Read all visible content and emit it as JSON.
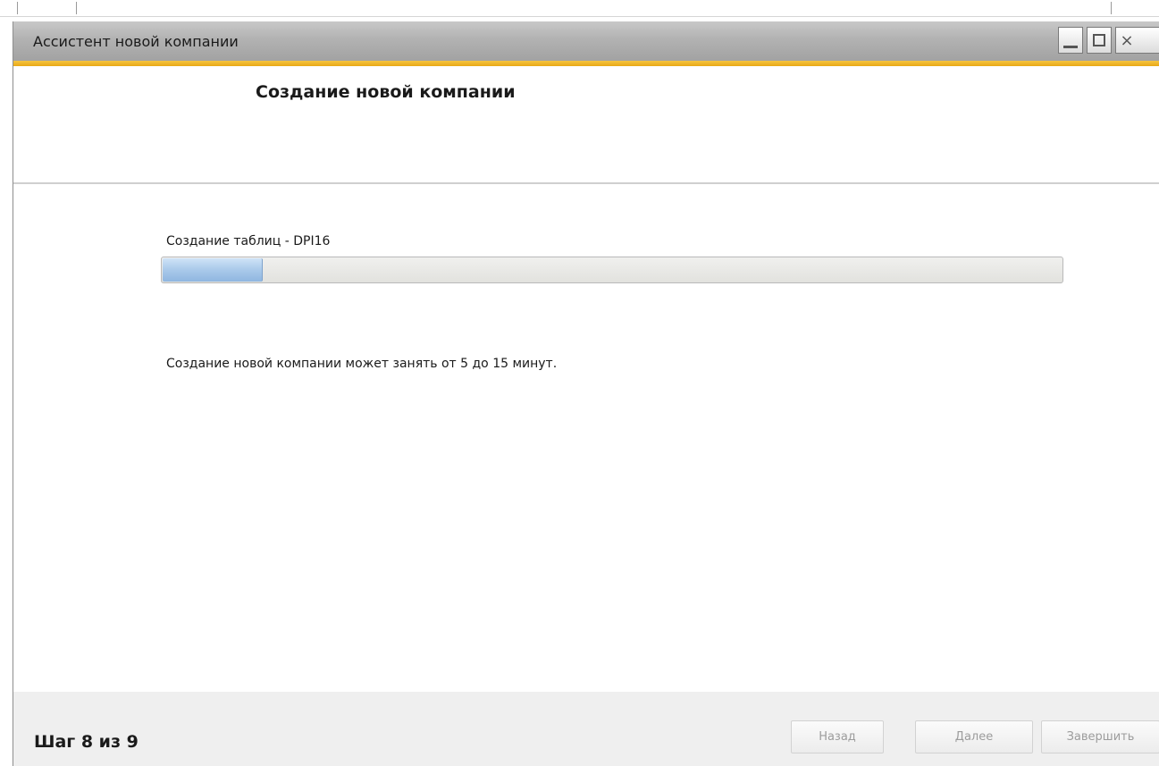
{
  "window": {
    "title": "Ассистент новой компании",
    "controls": {
      "minimize_icon": "minimize-icon",
      "maximize_icon": "maximize-icon",
      "close_glyph": "×"
    },
    "accent_color": "#f0b72f"
  },
  "header": {
    "title": "Создание новой компании"
  },
  "content": {
    "status_label": "Создание таблиц - DPI16",
    "progress_fraction": 0.11,
    "progress_color": "#a9c9ea",
    "note": "Создание новой компании может занять от 5 до 15 минут."
  },
  "footer": {
    "step_label": "Шаг 8 из 9",
    "buttons": {
      "back": "Назад",
      "next": "Далее",
      "finish": "Завершить"
    }
  }
}
